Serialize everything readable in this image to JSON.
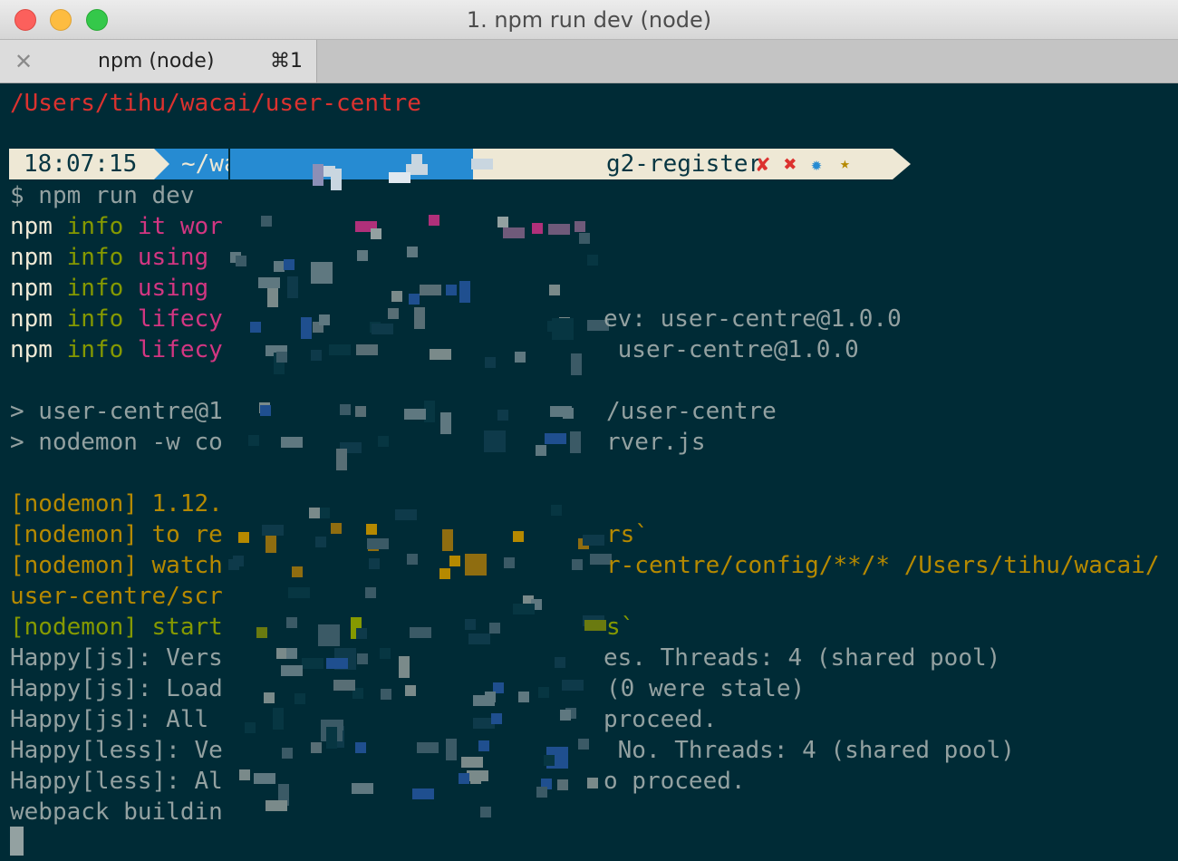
{
  "window": {
    "title": "1. npm run dev (node)"
  },
  "tabs": [
    {
      "label": "npm (node)",
      "shortcut": "⌘1",
      "close_icon": "✕"
    }
  ],
  "prompt": {
    "time": "18:07:15",
    "path_visible": "~/wa",
    "branch_visible": "g2-register",
    "status_symbols": [
      "✘",
      "✖",
      "✹",
      "★"
    ]
  },
  "lines": {
    "cwd": "/Users/tihu/wacai/user-centre",
    "command": "$ npm run dev",
    "npm1": {
      "a": "npm",
      "b": " info ",
      "c": "it wor",
      "tail": ""
    },
    "npm2": {
      "a": "npm",
      "b": " info ",
      "c": "using ",
      "tail": ""
    },
    "npm3": {
      "a": "npm",
      "b": " info ",
      "c": "using ",
      "tail": ""
    },
    "npm4": {
      "a": "npm",
      "b": " info ",
      "c": "lifecy",
      "tail": "ev: user-centre@1.0.0"
    },
    "npm5": {
      "a": "npm",
      "b": " info ",
      "c": "lifecy",
      "tail": " user-centre@1.0.0"
    },
    "run1": {
      "head": "> user-centre@1",
      "tail": "/user-centre"
    },
    "run2": {
      "head": "> nodemon -w co",
      "tail": "rver.js"
    },
    "nm1": {
      "head": "[nodemon] 1.12.",
      "tail": ""
    },
    "nm2": {
      "head": "[nodemon] to re",
      "tail": "rs`"
    },
    "nm3": {
      "head": "[nodemon] watch",
      "tail": "r-centre/config/**/* /Users/tihu/wacai/"
    },
    "nm4": {
      "head": "user-centre/scr",
      "tail": ""
    },
    "nm5": {
      "head": "[nodemon] start",
      "tail": "s`"
    },
    "h1": {
      "head": "Happy[js]: Vers",
      "tail": "es. Threads: 4 (shared pool)"
    },
    "h2": {
      "head": "Happy[js]: Load",
      "tail": "(0 were stale)"
    },
    "h3": {
      "head": "Happy[js]: All ",
      "tail": "proceed."
    },
    "h4": {
      "head": "Happy[less]: Ve",
      "tail": " No. Threads: 4 (shared pool)"
    },
    "h5": {
      "head": "Happy[less]: Al",
      "tail": "o proceed."
    },
    "wb": {
      "head": "webpack buildin",
      "tail": ""
    }
  },
  "colors": {
    "background": "#002b36",
    "text": "#93a1a1",
    "path_red": "#dc322f",
    "npm_white": "#eee8d5",
    "info_green": "#859900",
    "heading_magenta": "#d33682",
    "nodemon_yellow": "#b58900",
    "prompt_blue": "#268bd2",
    "prompt_cream": "#eee8d5"
  }
}
